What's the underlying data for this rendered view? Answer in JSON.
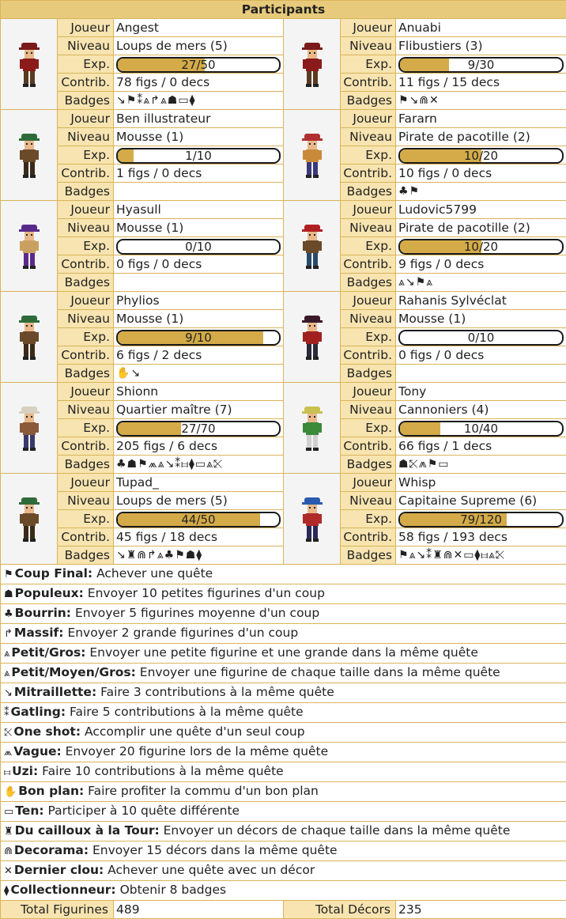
{
  "title": "Participants",
  "labels": {
    "player": "Joueur",
    "level": "Niveau",
    "exp": "Exp.",
    "contrib": "Contrib.",
    "badges": "Badges"
  },
  "players": [
    {
      "name": "Angest",
      "level": "Loups de mers (5)",
      "exp": "27/50",
      "exp_fraction": 0.54,
      "contrib": "78 figs / 0 decs",
      "badges": "↘⚑⁑⩓↱⩓☗▭⧫",
      "hat": "#7a1a1a",
      "shirt": "#8b1a1a",
      "pants": "#5a3a22"
    },
    {
      "name": "Anuabi",
      "level": "Flibustiers (3)",
      "exp": "9/30",
      "exp_fraction": 0.3,
      "contrib": "11 figs / 15 decs",
      "badges": "⚑↘⋒✕",
      "hat": "#7a1a1a",
      "shirt": "#8b1a1a",
      "pants": "#5a3a22"
    },
    {
      "name": "Ben illustrateur",
      "level": "Mousse (1)",
      "exp": "1/10",
      "exp_fraction": 0.1,
      "contrib": "1 figs / 0 decs",
      "badges": "",
      "hat": "#2f6b3a",
      "shirt": "#6b4a2a",
      "pants": "#3a2a1a"
    },
    {
      "name": "Fararn",
      "level": "Pirate de pacotille (2)",
      "exp": "10/20",
      "exp_fraction": 0.5,
      "contrib": "10 figs / 0 decs",
      "badges": "♣⚑",
      "hat": "#b03030",
      "shirt": "#c98a3a",
      "pants": "#3a3a7a"
    },
    {
      "name": "Hyasull",
      "level": "Mousse (1)",
      "exp": "0/10",
      "exp_fraction": 0.0,
      "contrib": "0 figs / 0 decs",
      "badges": "",
      "hat": "#5a2a8a",
      "shirt": "#c9a060",
      "pants": "#5a2a8a"
    },
    {
      "name": "Ludovic5799",
      "level": "Pirate de pacotille (2)",
      "exp": "10/20",
      "exp_fraction": 0.5,
      "contrib": "9 figs / 0 decs",
      "badges": "⩓↘⚑⩓",
      "hat": "#b02020",
      "shirt": "#6a4a2a",
      "pants": "#2a4a6a"
    },
    {
      "name": "Phylios",
      "level": "Mousse (1)",
      "exp": "9/10",
      "exp_fraction": 0.9,
      "contrib": "6 figs / 2 decs",
      "badges": "✋↘",
      "hat": "#2f6b3a",
      "shirt": "#6b4a2a",
      "pants": "#3a2a1a"
    },
    {
      "name": "Rahanis Sylvéclat",
      "level": "Mousse (1)",
      "exp": "0/10",
      "exp_fraction": 0.0,
      "contrib": "0 figs / 0 decs",
      "badges": "",
      "hat": "#3a1a2a",
      "shirt": "#a02020",
      "pants": "#2a2a3a"
    },
    {
      "name": "Shionn",
      "level": "Quartier maître (7)",
      "exp": "27/70",
      "exp_fraction": 0.39,
      "contrib": "205 figs / 6 decs",
      "badges": "♣☗⚑⩕⩓↘⁑⧦⧫▭⩓⤪",
      "hat": "#d8d0c0",
      "shirt": "#8a5a3a",
      "pants": "#3a3a6a"
    },
    {
      "name": "Tony",
      "level": "Cannoniers (4)",
      "exp": "10/40",
      "exp_fraction": 0.25,
      "contrib": "66 figs / 1 decs",
      "badges": "☗⤪⩕⚑▭",
      "hat": "#c8c050",
      "shirt": "#3a8a3a",
      "pants": "#d0d0d0"
    },
    {
      "name": "Tupad_",
      "level": "Loups de mers (5)",
      "exp": "44/50",
      "exp_fraction": 0.88,
      "contrib": "45 figs / 18 decs",
      "badges": "↘♜⋒↱⩓♣⚑☗⧫",
      "hat": "#2f6b3a",
      "shirt": "#6b4a2a",
      "pants": "#3a2a1a"
    },
    {
      "name": "Whisp",
      "level": "Capitaine Supreme (6)",
      "exp": "79/120",
      "exp_fraction": 0.66,
      "contrib": "58 figs / 193 decs",
      "badges": "⚑⩓↘⁑♜⋒✕▭⧫⧦⩓⤪",
      "hat": "#2a5ab0",
      "shirt": "#b02a2a",
      "pants": "#2a2a5a"
    }
  ],
  "legend": [
    {
      "icon": "⚑",
      "name": "Coup Final:",
      "desc": "Achever une quête"
    },
    {
      "icon": "☗",
      "name": "Populeux:",
      "desc": "Envoyer 10 petites figurines d'un coup"
    },
    {
      "icon": "♣",
      "name": "Bourrin:",
      "desc": "Envoyer 5 figurines moyenne d'un coup"
    },
    {
      "icon": "↱",
      "name": "Massif:",
      "desc": "Envoyer 2 grande figurines d'un coup"
    },
    {
      "icon": "⩓",
      "name": "Petit/Gros:",
      "desc": "Envoyer une petite figurine et une grande dans la même quête"
    },
    {
      "icon": "⩓",
      "name": "Petit/Moyen/Gros:",
      "desc": "Envoyer une figurine de chaque taille dans la même quête"
    },
    {
      "icon": "↘",
      "name": "Mitraillette:",
      "desc": "Faire 3 contributions à la même quête"
    },
    {
      "icon": "⁑",
      "name": "Gatling:",
      "desc": "Faire 5 contributions à la même quête"
    },
    {
      "icon": "⤪",
      "name": "One shot:",
      "desc": "Accomplir une quête d'un seul coup"
    },
    {
      "icon": "⩕",
      "name": "Vague:",
      "desc": "Envoyer 20 figurine lors de la même quête"
    },
    {
      "icon": "⧦",
      "name": "Uzi:",
      "desc": "Faire 10 contributions à la même quête"
    },
    {
      "icon": "✋",
      "name": "Bon plan:",
      "desc": "Faire profiter la commu d'un bon plan"
    },
    {
      "icon": "▭",
      "name": "Ten:",
      "desc": "Participer à 10 quête différente"
    },
    {
      "icon": "♜",
      "name": "Du cailloux à la Tour:",
      "desc": "Envoyer un décors de chaque taille dans la même quête"
    },
    {
      "icon": "⋒",
      "name": "Decorama:",
      "desc": "Envoyer 15 décors dans la même quête"
    },
    {
      "icon": "✕",
      "name": "Dernier clou:",
      "desc": "Achever une quête avec un décor"
    },
    {
      "icon": "⧫",
      "name": "Collectionneur:",
      "desc": "Obtenir 8 badges"
    }
  ],
  "totals": {
    "figs_label": "Total Figurines",
    "figs_value": "489",
    "decs_label": "Total Décors",
    "decs_value": "235"
  }
}
